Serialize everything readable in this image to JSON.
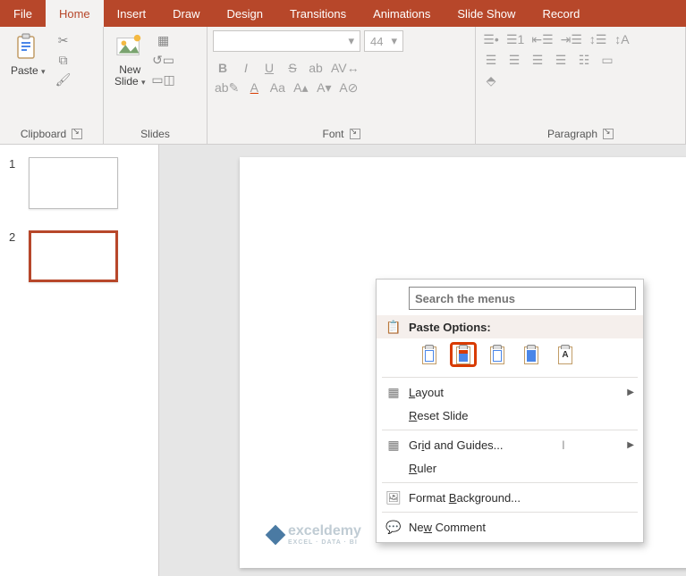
{
  "tabs": [
    "File",
    "Home",
    "Insert",
    "Draw",
    "Design",
    "Transitions",
    "Animations",
    "Slide Show",
    "Record"
  ],
  "active_tab": "Home",
  "groups": {
    "clipboard": {
      "label": "Clipboard",
      "paste": "Paste"
    },
    "slides": {
      "label": "Slides",
      "newslide": "New\nSlide"
    },
    "font": {
      "label": "Font",
      "size_placeholder": "44"
    },
    "paragraph": {
      "label": "Paragraph"
    }
  },
  "thumbs": [
    {
      "num": "1",
      "selected": false
    },
    {
      "num": "2",
      "selected": true
    }
  ],
  "context_menu": {
    "search_placeholder": "Search the menus",
    "paste_header": "Paste Options:",
    "items": {
      "layout": "Layout",
      "reset": "Reset Slide",
      "grid": "Grid and Guides...",
      "ruler": "Ruler",
      "format_bg": "Format Background...",
      "new_comment": "New Comment"
    }
  },
  "watermark": {
    "text": "exceldemy",
    "sub": "EXCEL · DATA · BI"
  }
}
